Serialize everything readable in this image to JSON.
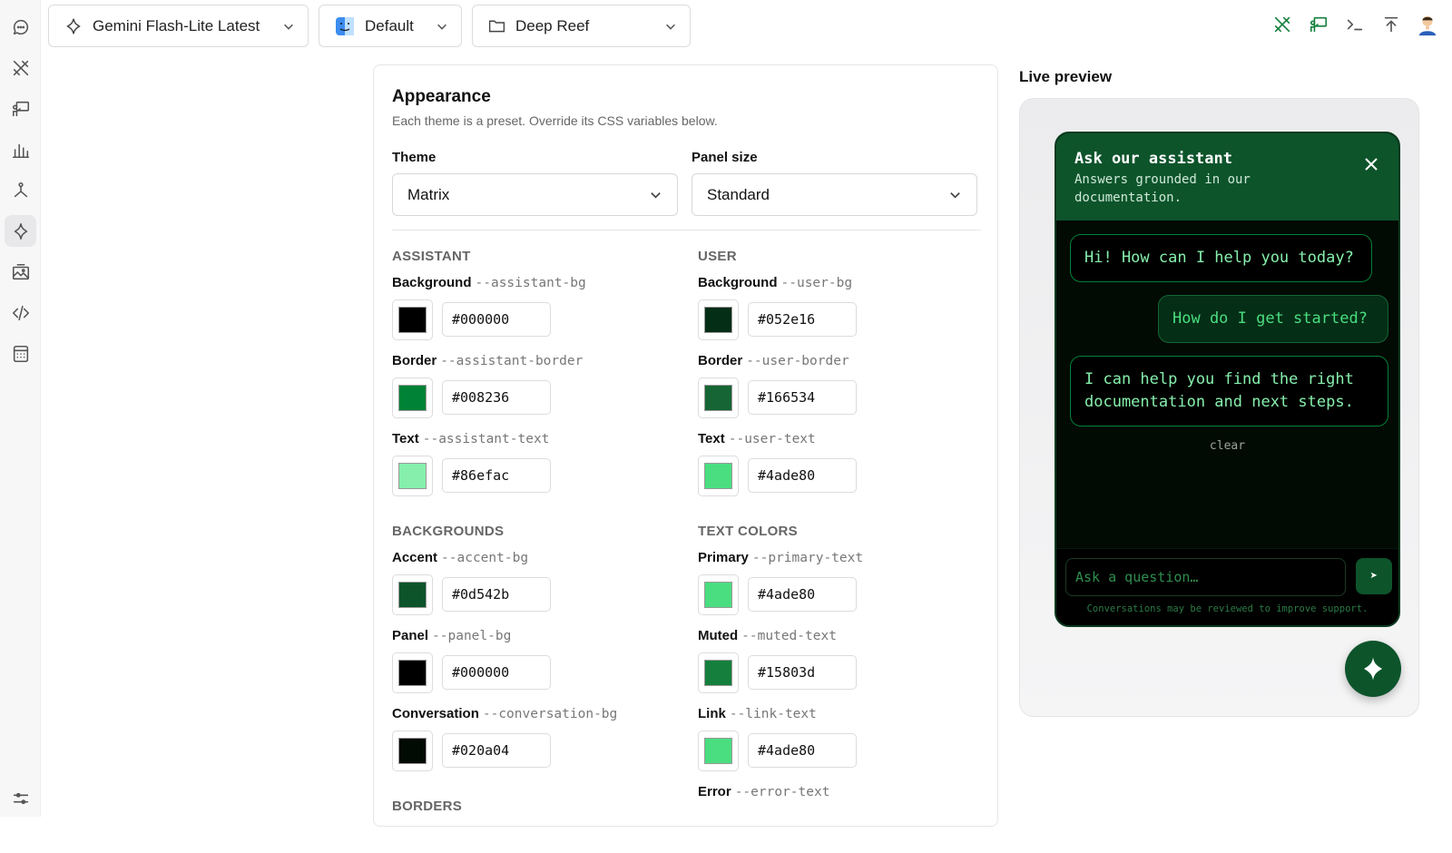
{
  "topbar": {
    "model_label": "Gemini Flash-Lite Latest",
    "profile_label": "Default",
    "project_label": "Deep Reef"
  },
  "rail": {
    "icons": [
      "chat-icon",
      "tools-icon",
      "presenter-icon",
      "bar-chart-icon",
      "network-icon",
      "sparkle-icon",
      "image-gallery-icon",
      "code-icon",
      "calculator-icon",
      "sliders-icon"
    ],
    "active": "sparkle-icon"
  },
  "appearance": {
    "title": "Appearance",
    "subtitle": "Each theme is a preset. Override its CSS variables below.",
    "theme_label": "Theme",
    "theme_value": "Matrix",
    "panel_size_label": "Panel size",
    "panel_size_value": "Standard",
    "sections": {
      "assistant": {
        "heading": "ASSISTANT",
        "fields": [
          {
            "label": "Background",
            "var": "--assistant-bg",
            "value": "#000000"
          },
          {
            "label": "Border",
            "var": "--assistant-border",
            "value": "#008236"
          },
          {
            "label": "Text",
            "var": "--assistant-text",
            "value": "#86efac"
          }
        ]
      },
      "user": {
        "heading": "USER",
        "fields": [
          {
            "label": "Background",
            "var": "--user-bg",
            "value": "#052e16"
          },
          {
            "label": "Border",
            "var": "--user-border",
            "value": "#166534"
          },
          {
            "label": "Text",
            "var": "--user-text",
            "value": "#4ade80"
          }
        ]
      },
      "backgrounds": {
        "heading": "BACKGROUNDS",
        "fields": [
          {
            "label": "Accent",
            "var": "--accent-bg",
            "value": "#0d542b"
          },
          {
            "label": "Panel",
            "var": "--panel-bg",
            "value": "#000000"
          },
          {
            "label": "Conversation",
            "var": "--conversation-bg",
            "value": "#020a04"
          }
        ]
      },
      "text_colors": {
        "heading": "TEXT COLORS",
        "fields": [
          {
            "label": "Primary",
            "var": "--primary-text",
            "value": "#4ade80"
          },
          {
            "label": "Muted",
            "var": "--muted-text",
            "value": "#15803d"
          },
          {
            "label": "Link",
            "var": "--link-text",
            "value": "#4ade80"
          },
          {
            "label": "Error",
            "var": "--error-text",
            "value": ""
          }
        ]
      },
      "borders": {
        "heading": "BORDERS"
      }
    }
  },
  "preview": {
    "title": "Live preview",
    "header_title": "Ask our assistant",
    "header_subtitle": "Answers grounded in our documentation.",
    "messages": [
      {
        "role": "assistant",
        "text": "Hi! How can I help you today?"
      },
      {
        "role": "user",
        "text": "How do I get started?"
      },
      {
        "role": "assistant",
        "text": "I can help you find the right documentation and next steps."
      }
    ],
    "clear_label": "clear",
    "input_placeholder": "Ask a question…",
    "send_glyph": "➤",
    "footer_note": "Conversations may be reviewed to improve support."
  }
}
